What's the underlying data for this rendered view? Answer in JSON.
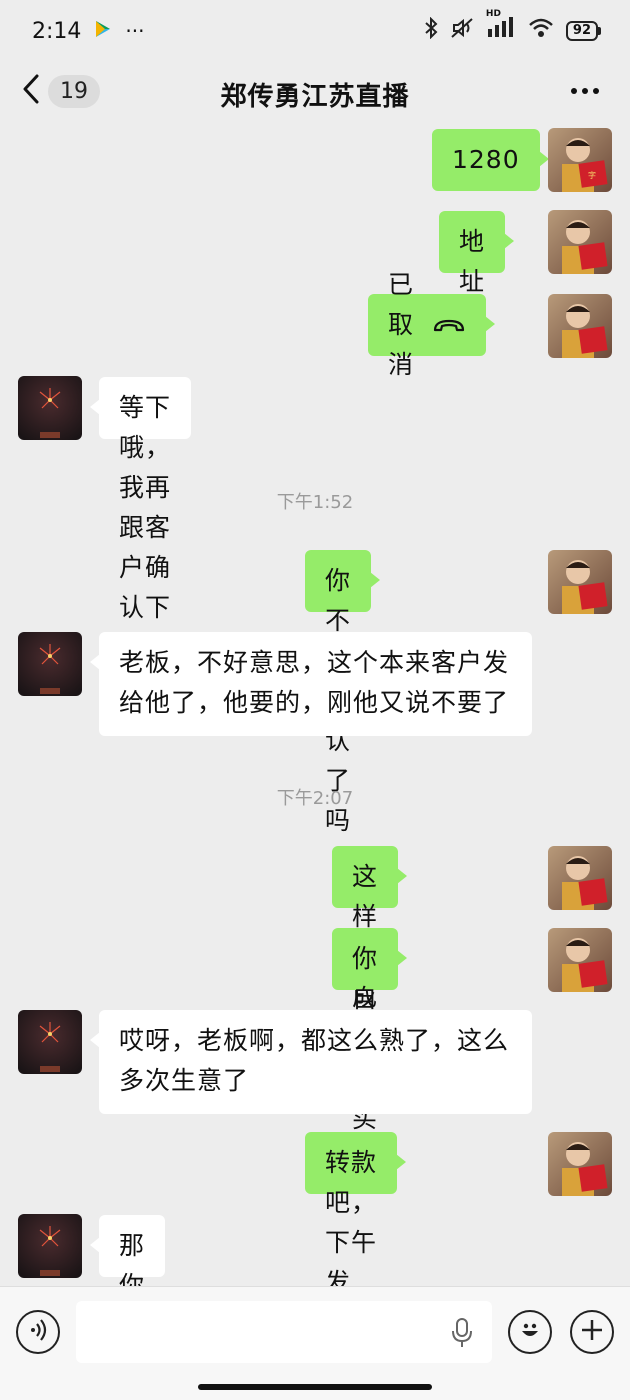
{
  "status_bar": {
    "time": "2:14",
    "dots": "···",
    "hd_label": "HD",
    "battery": "92"
  },
  "nav": {
    "unread_count": "19",
    "title": "郑传勇江苏直播"
  },
  "messages": [
    {
      "side": "right",
      "text": "1280"
    },
    {
      "side": "right",
      "text": "地址"
    },
    {
      "side": "right",
      "text": "已取消",
      "icon": "hangup-icon"
    },
    {
      "side": "left",
      "text": "等下哦，我再跟客户确认下"
    },
    {
      "type": "timestamp",
      "text": "下午1:52"
    },
    {
      "side": "right",
      "text": "你不是确认了吗"
    },
    {
      "side": "left",
      "text_line1": "老板，不好意思，这个本来客户发",
      "text_line2": "给他了，他要的，刚他又说不要了"
    },
    {
      "type": "timestamp",
      "text": "下午2:07"
    },
    {
      "side": "right",
      "text": "这样能成立吗"
    },
    {
      "side": "right",
      "text": "你自己得买了"
    },
    {
      "side": "left",
      "text_line1": "哎呀，老板啊，都这么熟了，这么",
      "text_line2": "多次生意了"
    },
    {
      "side": "right",
      "text": "转款吧，下午发"
    },
    {
      "side": "left",
      "text": "那你仲裁吧"
    }
  ],
  "input_bar": {
    "placeholder": ""
  },
  "colors": {
    "sent_bubble": "#95ec69",
    "received_bubble": "#ffffff",
    "background": "#ededed"
  }
}
